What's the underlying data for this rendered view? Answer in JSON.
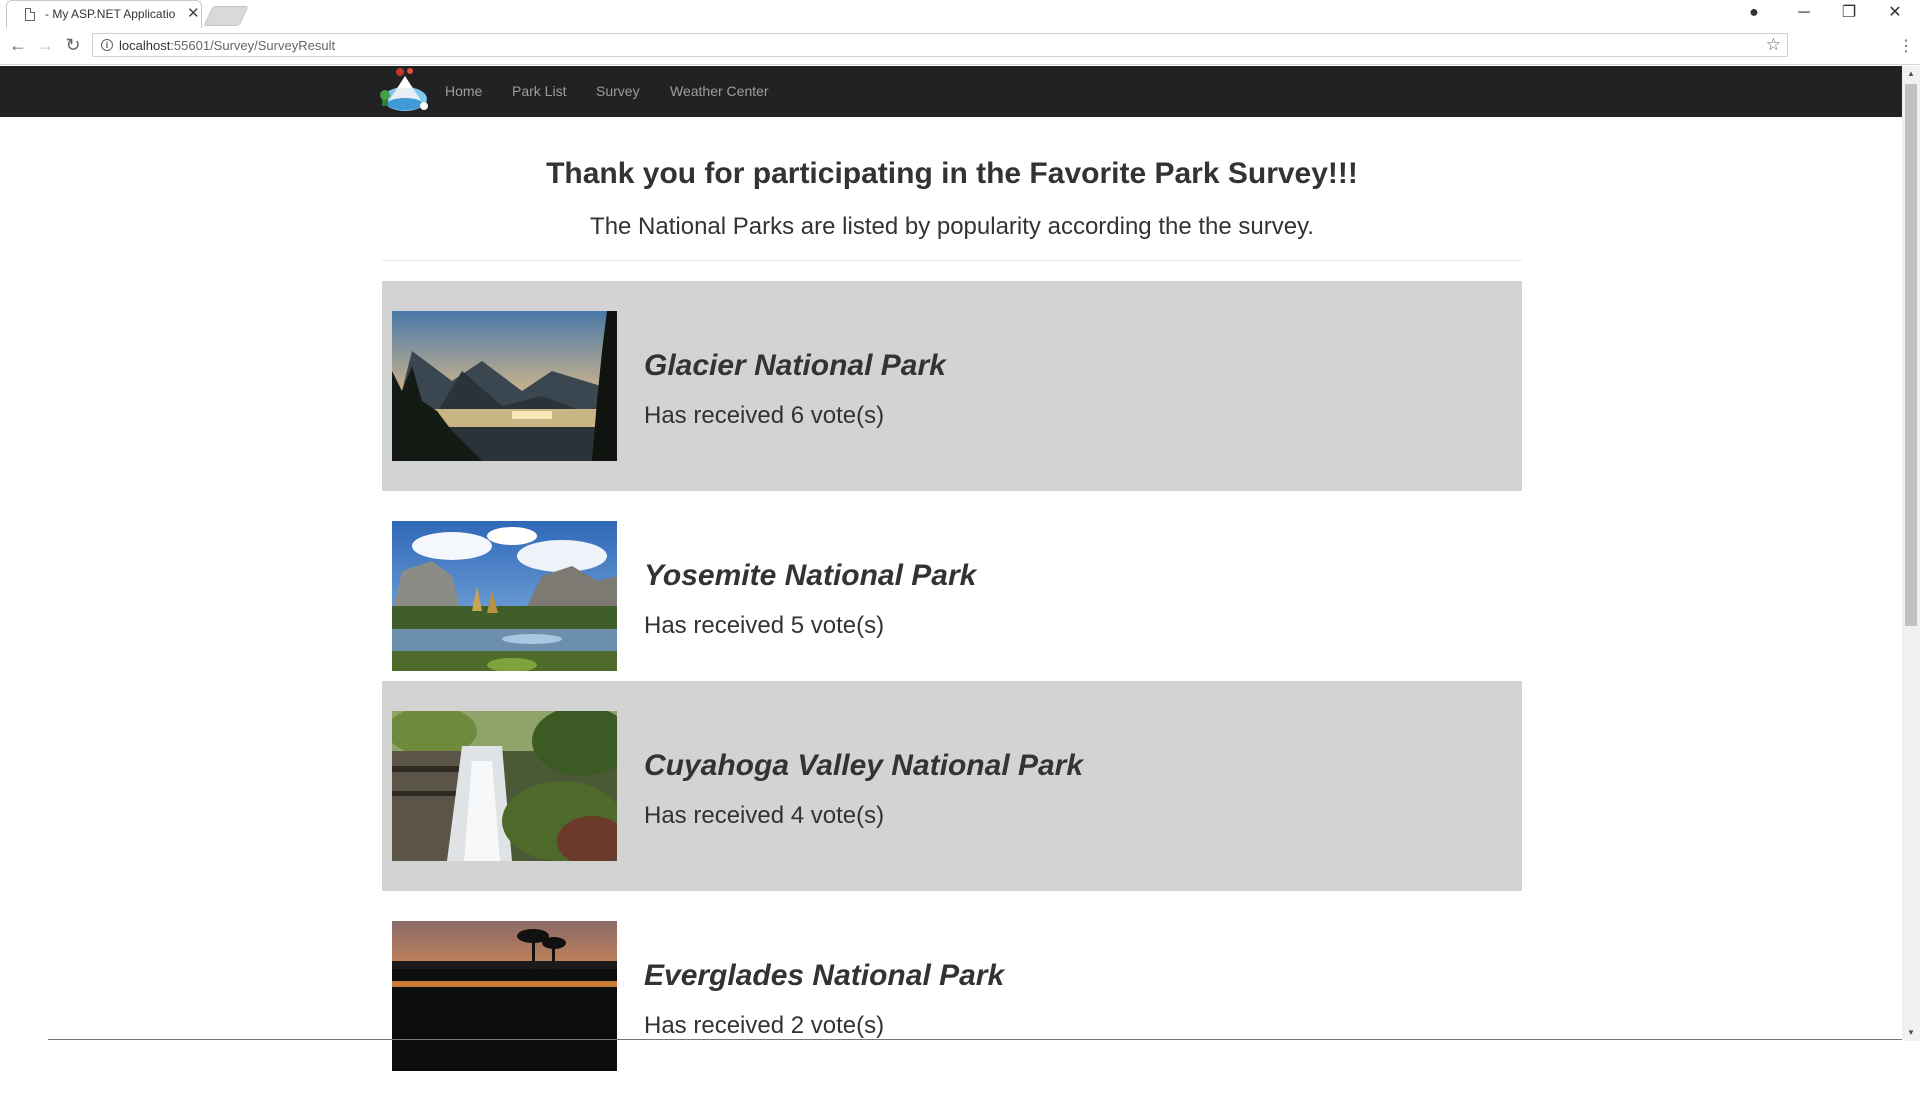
{
  "browser": {
    "tab_title": "- My ASP.NET Applicatio",
    "tab_close": "✕",
    "url_host": "localhost",
    "url_path": ":55601/Survey/SurveyResult",
    "controls": {
      "minimize": "─",
      "restore": "❐",
      "close": "✕",
      "account": "●"
    },
    "nav": {
      "back": "←",
      "forward": "→",
      "reload": "↻"
    },
    "star": "☆",
    "menu": "⋮"
  },
  "navbar": {
    "links": [
      "Home",
      "Park List",
      "Survey",
      "Weather Center"
    ]
  },
  "page": {
    "heading": "Thank you for participating in the Favorite Park Survey!!!",
    "subheading": "The National Parks are listed by popularity according the the survey."
  },
  "parks": [
    {
      "name": "Glacier National Park",
      "votes_text": "Has received 6 vote(s)",
      "shaded": true
    },
    {
      "name": "Yosemite National Park",
      "votes_text": "Has received 5 vote(s)",
      "shaded": false
    },
    {
      "name": "Cuyahoga Valley National Park",
      "votes_text": "Has received 4 vote(s)",
      "shaded": true
    },
    {
      "name": "Everglades National Park",
      "votes_text": "Has received 2 vote(s)",
      "shaded": false
    }
  ]
}
